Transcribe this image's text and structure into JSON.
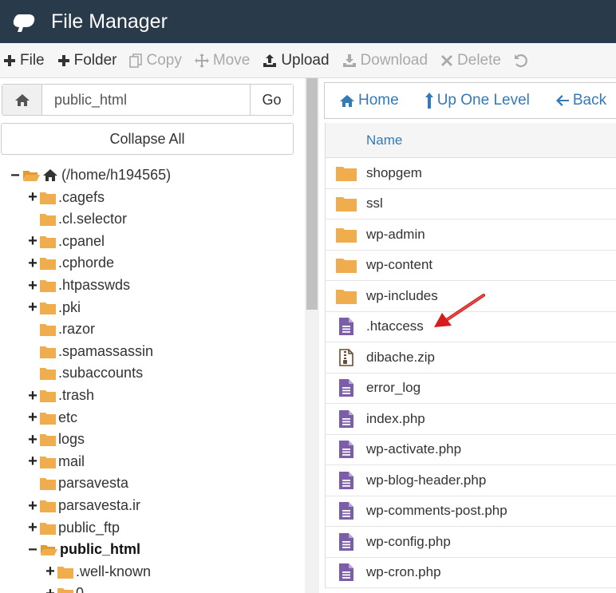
{
  "app": {
    "title": "File Manager"
  },
  "toolbar": [
    {
      "label": "File",
      "icon": "plus-icon",
      "enabled": true
    },
    {
      "label": "Folder",
      "icon": "plus-icon",
      "enabled": true
    },
    {
      "label": "Copy",
      "icon": "copy-icon",
      "enabled": false
    },
    {
      "label": "Move",
      "icon": "move-icon",
      "enabled": false
    },
    {
      "label": "Upload",
      "icon": "upload-icon",
      "enabled": true
    },
    {
      "label": "Download",
      "icon": "download-icon",
      "enabled": false
    },
    {
      "label": "Delete",
      "icon": "delete-icon",
      "enabled": false
    }
  ],
  "left": {
    "path_value": "public_html",
    "go_label": "Go",
    "collapse_label": "Collapse All",
    "tree": [
      {
        "label": "(/home/h194565)",
        "toggle": "−",
        "open": true,
        "home": true,
        "bold": false
      },
      {
        "label": ".cagefs",
        "toggle": "+",
        "bold": false
      },
      {
        "label": ".cl.selector",
        "toggle": "",
        "bold": false
      },
      {
        "label": ".cpanel",
        "toggle": "+",
        "bold": false
      },
      {
        "label": ".cphorde",
        "toggle": "+",
        "bold": false
      },
      {
        "label": ".htpasswds",
        "toggle": "+",
        "bold": false
      },
      {
        "label": ".pki",
        "toggle": "+",
        "bold": false
      },
      {
        "label": ".razor",
        "toggle": "",
        "bold": false
      },
      {
        "label": ".spamassassin",
        "toggle": "",
        "bold": false
      },
      {
        "label": ".subaccounts",
        "toggle": "",
        "bold": false
      },
      {
        "label": ".trash",
        "toggle": "+",
        "bold": false
      },
      {
        "label": "etc",
        "toggle": "+",
        "bold": false
      },
      {
        "label": "logs",
        "toggle": "+",
        "bold": false
      },
      {
        "label": "mail",
        "toggle": "+",
        "bold": false
      },
      {
        "label": "parsavesta",
        "toggle": "",
        "bold": false
      },
      {
        "label": "parsavesta.ir",
        "toggle": "+",
        "bold": false
      },
      {
        "label": "public_ftp",
        "toggle": "+",
        "bold": false
      },
      {
        "label": "public_html",
        "toggle": "−",
        "open": true,
        "bold": true
      },
      {
        "label": ".well-known",
        "toggle": "+",
        "bold": false
      },
      {
        "label": "0",
        "toggle": "+",
        "bold": false
      }
    ]
  },
  "right": {
    "nav": [
      {
        "label": "Home",
        "icon": "home-icon"
      },
      {
        "label": "Up One Level",
        "icon": "level-up-icon"
      },
      {
        "label": "Back",
        "icon": "back-arrow-icon"
      }
    ],
    "column_name": "Name",
    "files": [
      {
        "name": "shopgem",
        "type": "folder"
      },
      {
        "name": "ssl",
        "type": "folder"
      },
      {
        "name": "wp-admin",
        "type": "folder"
      },
      {
        "name": "wp-content",
        "type": "folder"
      },
      {
        "name": "wp-includes",
        "type": "folder"
      },
      {
        "name": ".htaccess",
        "type": "text"
      },
      {
        "name": "dibache.zip",
        "type": "zip"
      },
      {
        "name": "error_log",
        "type": "text"
      },
      {
        "name": "index.php",
        "type": "text"
      },
      {
        "name": "wp-activate.php",
        "type": "text"
      },
      {
        "name": "wp-blog-header.php",
        "type": "text"
      },
      {
        "name": "wp-comments-post.php",
        "type": "text"
      },
      {
        "name": "wp-config.php",
        "type": "text"
      },
      {
        "name": "wp-cron.php",
        "type": "text"
      }
    ]
  },
  "colors": {
    "topbar": "#293a4a",
    "link": "#337ab7",
    "folder": "#f0ad4e",
    "file_icon": "#7b5ea7",
    "arrow": "#e31b1b"
  }
}
